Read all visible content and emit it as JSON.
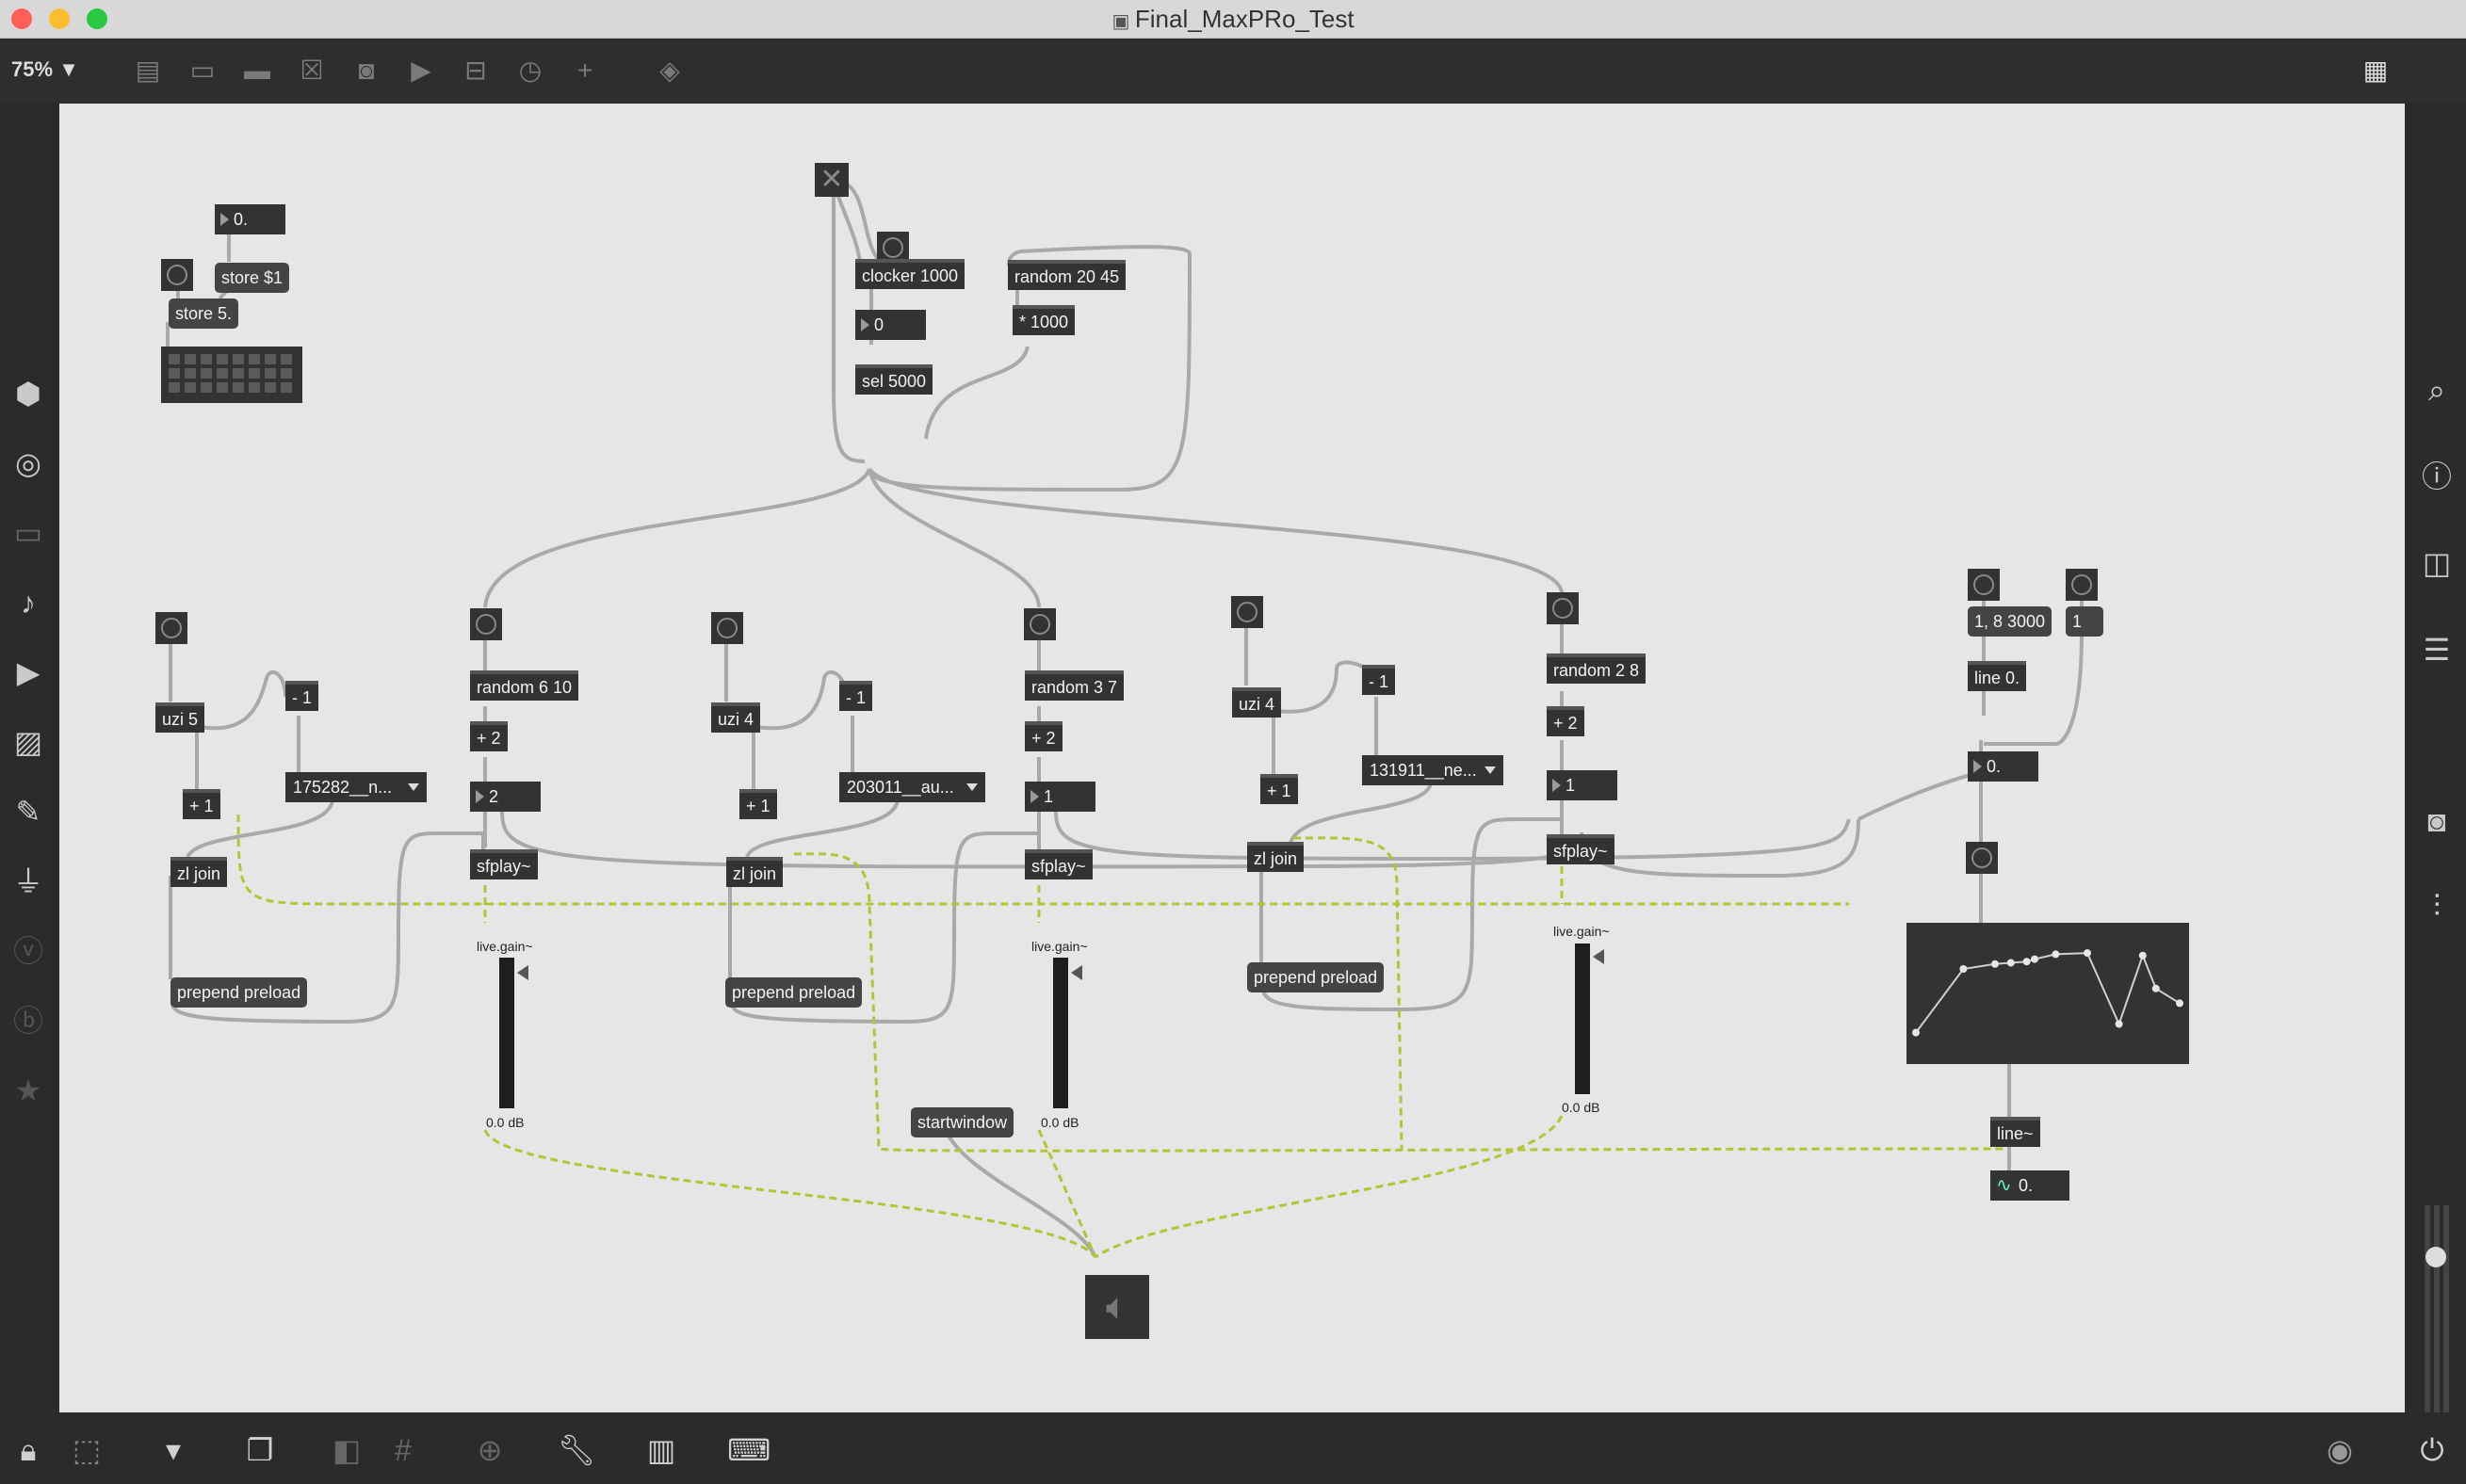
{
  "window": {
    "title": "Final_MaxPRo_Test"
  },
  "colors": {
    "close": "#ff5f57",
    "minimize": "#febc2e",
    "zoom": "#28c840",
    "patchcord": "#a9a9a9",
    "signalcord": "#b5c437"
  },
  "toolbar": {
    "zoom": "75% ▼"
  },
  "patch": {
    "topleft": {
      "num": "0.",
      "store1": "store $1",
      "store5": "store 5."
    },
    "clock": {
      "clocker": "clocker 1000",
      "random": "random 20 45",
      "mult": "* 1000",
      "num": "0",
      "sel": "sel 5000"
    },
    "col1": {
      "uzi": "uzi 5",
      "minus": "- 1",
      "plus": "+ 1",
      "menu": "175282__n...",
      "zl": "zl join",
      "prepend": "prepend preload"
    },
    "col2": {
      "random": "random 6 10",
      "plus": "+ 2",
      "num": "2",
      "sfplay": "sfplay~",
      "gain": "live.gain~",
      "db": "0.0 dB"
    },
    "col3": {
      "uzi": "uzi 4",
      "minus": "- 1",
      "plus": "+ 1",
      "menu": "203011__au...",
      "zl": "zl join",
      "prepend": "prepend preload"
    },
    "col4": {
      "random": "random 3 7",
      "plus": "+ 2",
      "num": "1",
      "sfplay": "sfplay~",
      "gain": "live.gain~",
      "db": "0.0 dB"
    },
    "col5": {
      "uzi": "uzi 4",
      "minus": "- 1",
      "plus": "+ 1",
      "menu": "131911__ne...",
      "zl": "zl join",
      "prepend": "prepend preload"
    },
    "col6": {
      "random": "random 2 8",
      "plus": "+ 2",
      "num": "1",
      "sfplay": "sfplay~",
      "gain": "live.gain~",
      "db": "0.0 dB"
    },
    "env": {
      "msg1": "1, 8 3000",
      "msg2": "1",
      "line": "line 0.",
      "num": "0.",
      "linesig": "line~",
      "signum": "0."
    },
    "startwindow": "startwindow"
  },
  "function_points": [
    [
      0,
      0.82
    ],
    [
      0.18,
      0.3
    ],
    [
      0.3,
      0.26
    ],
    [
      0.36,
      0.25
    ],
    [
      0.42,
      0.24
    ],
    [
      0.45,
      0.22
    ],
    [
      0.53,
      0.18
    ],
    [
      0.65,
      0.17
    ],
    [
      0.77,
      0.75
    ],
    [
      0.86,
      0.19
    ],
    [
      0.91,
      0.46
    ],
    [
      1,
      0.58
    ]
  ]
}
